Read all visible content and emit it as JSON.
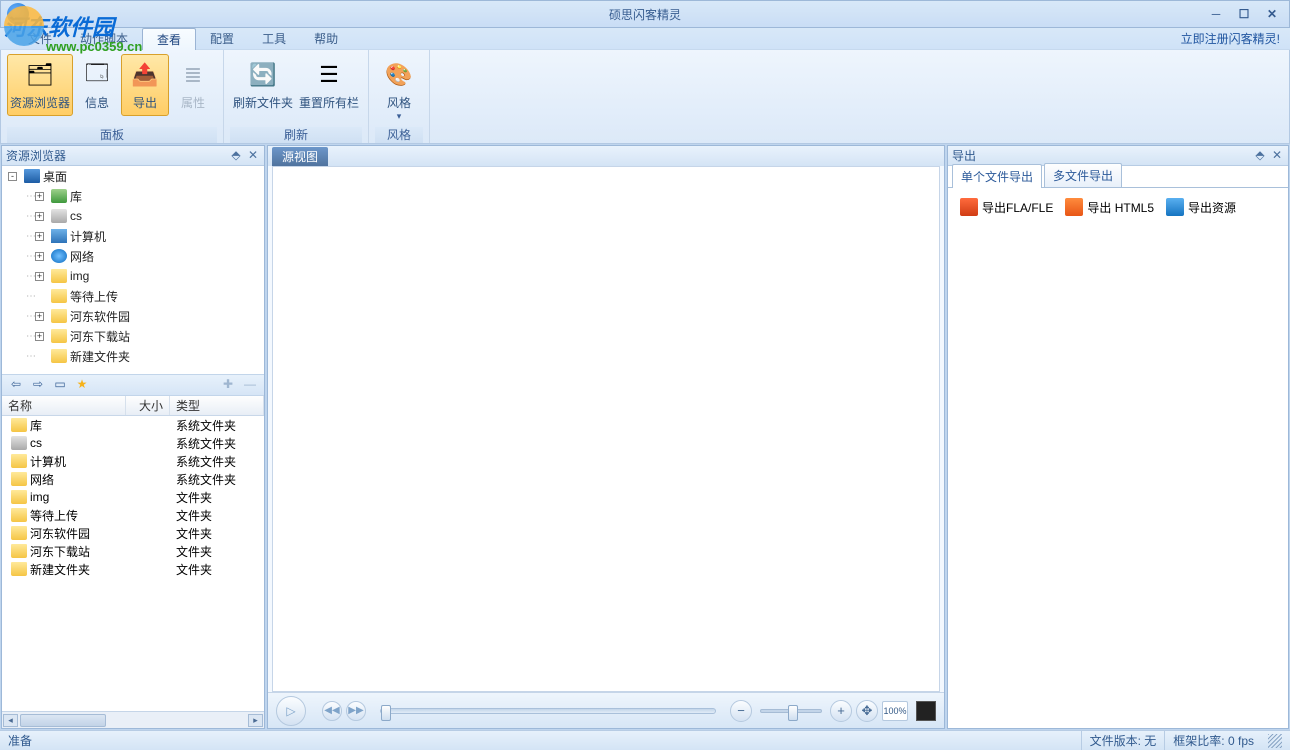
{
  "title": "硕思闪客精灵",
  "watermark": {
    "line1": "河东软件园",
    "line2": "www.pc0359.cn"
  },
  "menu": {
    "items": [
      "文件",
      "动作脚本",
      "查看",
      "配置",
      "工具",
      "帮助"
    ],
    "active_index": 2,
    "register": "立即注册闪客精灵!"
  },
  "ribbon": {
    "groups": [
      {
        "label": "面板",
        "buttons": [
          {
            "label": "资源浏览器",
            "active": true,
            "wide": true,
            "icon": "🗂"
          },
          {
            "label": "信息",
            "active": false,
            "icon": "🗔"
          },
          {
            "label": "导出",
            "active": true,
            "icon": "📤"
          },
          {
            "label": "属性",
            "disabled": true,
            "icon": "≣"
          }
        ]
      },
      {
        "label": "刷新",
        "buttons": [
          {
            "label": "刷新文件夹",
            "wide": true,
            "icon": "🔄"
          },
          {
            "label": "重置所有栏",
            "wide": true,
            "icon": "☰"
          }
        ]
      },
      {
        "label": "风格",
        "buttons": [
          {
            "label": "风格",
            "icon": "🎨",
            "dropdown": true
          }
        ]
      }
    ]
  },
  "left": {
    "title": "资源浏览器",
    "tree": [
      {
        "indent": 0,
        "toggle": "-",
        "icon": "desktop",
        "label": "桌面"
      },
      {
        "indent": 1,
        "toggle": "+",
        "icon": "lib",
        "label": "库"
      },
      {
        "indent": 1,
        "toggle": "+",
        "icon": "disk",
        "label": "cs"
      },
      {
        "indent": 1,
        "toggle": "+",
        "icon": "computer",
        "label": "计算机"
      },
      {
        "indent": 1,
        "toggle": "+",
        "icon": "network",
        "label": "网络"
      },
      {
        "indent": 1,
        "toggle": "+",
        "icon": "folder",
        "label": "img"
      },
      {
        "indent": 1,
        "toggle": "",
        "icon": "folder",
        "label": "等待上传"
      },
      {
        "indent": 1,
        "toggle": "+",
        "icon": "folder",
        "label": "河东软件园"
      },
      {
        "indent": 1,
        "toggle": "+",
        "icon": "folder",
        "label": "河东下载站"
      },
      {
        "indent": 1,
        "toggle": "",
        "icon": "folder",
        "label": "新建文件夹"
      }
    ],
    "columns": {
      "name": "名称",
      "size": "大小",
      "type": "类型"
    },
    "rows": [
      {
        "name": "库",
        "icon": "folder",
        "size": "",
        "type": "系统文件夹"
      },
      {
        "name": "cs",
        "icon": "disk",
        "size": "",
        "type": "系统文件夹"
      },
      {
        "name": "计算机",
        "icon": "folder",
        "size": "",
        "type": "系统文件夹"
      },
      {
        "name": "网络",
        "icon": "folder",
        "size": "",
        "type": "系统文件夹"
      },
      {
        "name": "img",
        "icon": "folder",
        "size": "",
        "type": "文件夹"
      },
      {
        "name": "等待上传",
        "icon": "folder",
        "size": "",
        "type": "文件夹"
      },
      {
        "name": "河东软件园",
        "icon": "folder",
        "size": "",
        "type": "文件夹"
      },
      {
        "name": "河东下载站",
        "icon": "folder",
        "size": "",
        "type": "文件夹"
      },
      {
        "name": "新建文件夹",
        "icon": "folder",
        "size": "",
        "type": "文件夹"
      }
    ]
  },
  "center": {
    "tab": "源视图"
  },
  "right": {
    "title": "导出",
    "tabs": [
      "单个文件导出",
      "多文件导出"
    ],
    "active_tab": 0,
    "items": [
      {
        "label": "导出FLA/FLE",
        "icon": "fla"
      },
      {
        "label": "导出 HTML5",
        "icon": "html5"
      },
      {
        "label": "导出资源",
        "icon": "res"
      }
    ]
  },
  "status": {
    "ready": "准备",
    "version_label": "文件版本:",
    "version_value": "无",
    "framerate_label": "框架比率:",
    "framerate_value": "0 fps"
  }
}
